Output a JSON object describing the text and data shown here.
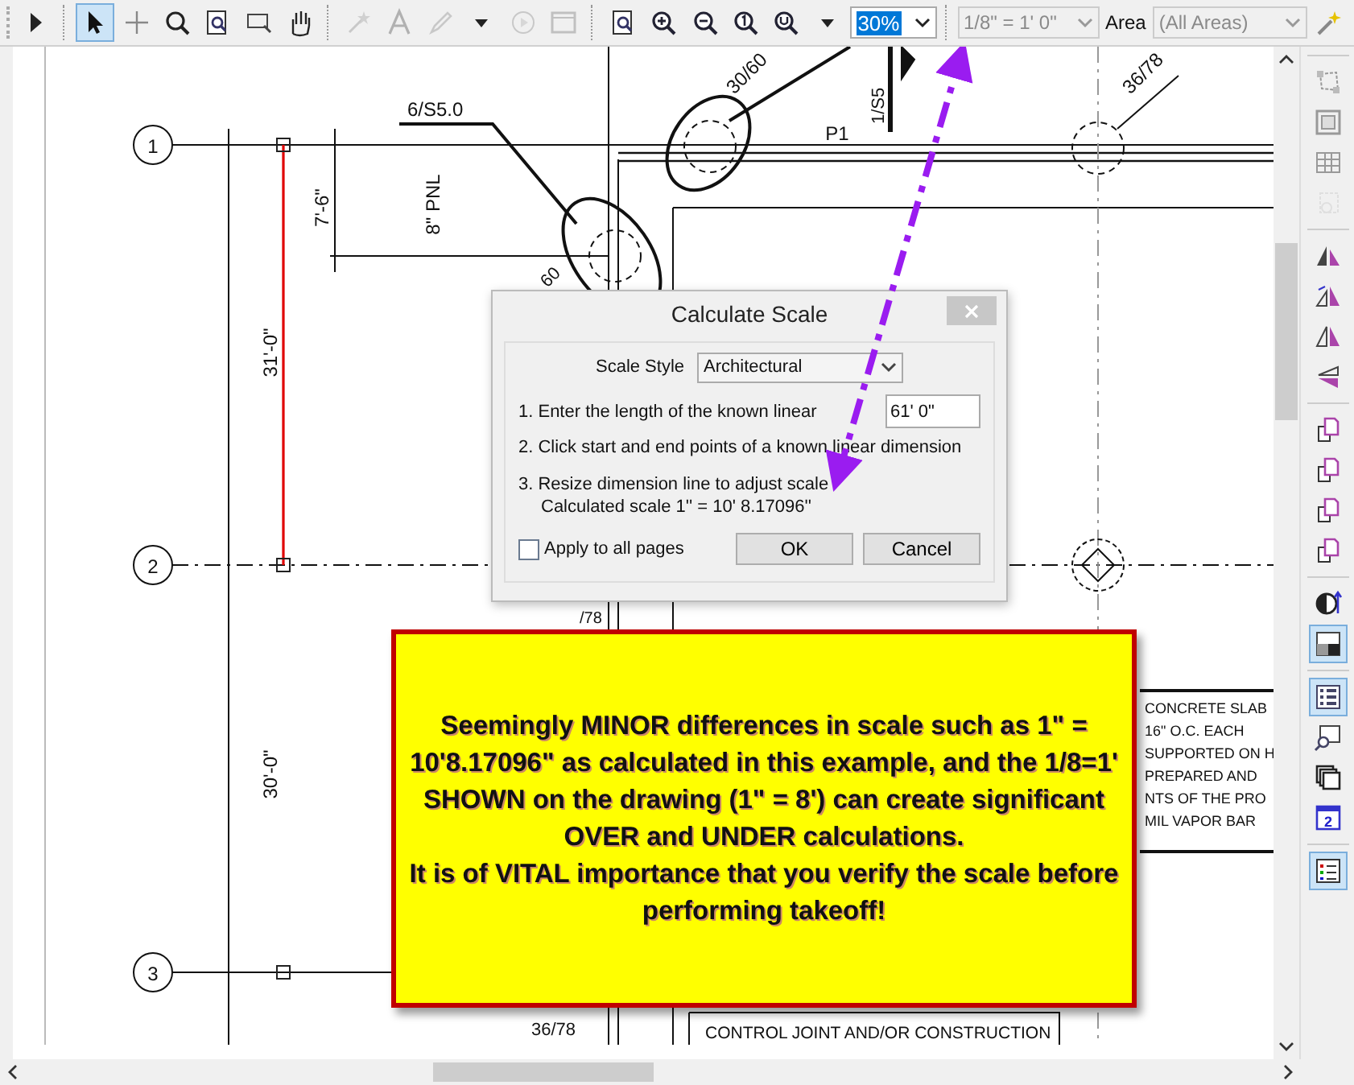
{
  "toolbar": {
    "tools": [
      {
        "kind": "play",
        "selected": false,
        "disabled": false
      },
      {
        "kind": "sep"
      },
      {
        "kind": "pointer",
        "selected": true,
        "disabled": false
      },
      {
        "kind": "crosshair",
        "selected": false,
        "disabled": false
      },
      {
        "kind": "zoom",
        "selected": false,
        "disabled": false
      },
      {
        "kind": "zoom-page",
        "selected": false,
        "disabled": false
      },
      {
        "kind": "zoom-rect",
        "selected": false,
        "disabled": false
      },
      {
        "kind": "hand",
        "selected": false,
        "disabled": false
      },
      {
        "kind": "sep"
      },
      {
        "kind": "star-pen",
        "selected": false,
        "disabled": true
      },
      {
        "kind": "letter",
        "selected": false,
        "disabled": true
      },
      {
        "kind": "pencil",
        "selected": false,
        "disabled": true
      },
      {
        "kind": "caret",
        "selected": false,
        "disabled": false
      },
      {
        "kind": "circle-play",
        "selected": false,
        "disabled": true
      },
      {
        "kind": "window",
        "selected": false,
        "disabled": true
      },
      {
        "kind": "sep"
      },
      {
        "kind": "zoom-page",
        "selected": false,
        "disabled": false
      },
      {
        "kind": "zoom-in",
        "selected": false,
        "disabled": false
      },
      {
        "kind": "zoom-out",
        "selected": false,
        "disabled": false
      },
      {
        "kind": "zoom-one",
        "selected": false,
        "disabled": false
      },
      {
        "kind": "zoom-u",
        "selected": false,
        "disabled": false
      },
      {
        "kind": "caret",
        "selected": false,
        "disabled": false
      }
    ],
    "zoom_field": {
      "value": "30%"
    },
    "scale_select": {
      "value": "1/8\" = 1' 0\"",
      "disabled": true
    },
    "area_label": "Area",
    "area_select": {
      "value": "(All Areas)",
      "disabled": true
    }
  },
  "drawing": {
    "labels": [
      "1",
      "2",
      "3",
      "6/S5.0",
      "7'-6\"",
      "8\" PNL",
      "30/60",
      "P1",
      "1/S5",
      "36/78",
      "31'-0\"",
      "30'-0\"",
      "60",
      "36/78",
      "/78",
      "CONCRETE SLAB",
      "16\" O.C. EACH",
      "SUPPORTED ON H",
      "PREPARED AND",
      "NTS OF THE PRO",
      "MIL VAPOR BAR",
      "CONTROL JOINT AND/OR CONSTRUCTION"
    ]
  },
  "dialog": {
    "title": "Calculate Scale",
    "scale_style_label": "Scale Style",
    "scale_style_value": "Architectural",
    "step_1": "1. Enter the length of the known linear",
    "length_value": "61' 0\"",
    "step_2": "2. Click start and end points of a known linear dimension",
    "step_3": "3. Resize dimension line to adjust scale",
    "calculated": "Calculated scale  1'' = 10' 8.17096''",
    "apply_all": {
      "label": "Apply to all pages",
      "checked": false
    },
    "buttons": [
      "OK",
      "Cancel"
    ]
  },
  "callout": {
    "paragraphs": [
      "Seemingly MINOR differences in scale such as 1\" = 10'8.17096\" as calculated in this example, and the 1/8=1' SHOWN on the drawing (1\" = 8') can create significant OVER and UNDER calculations.",
      "It is of VITAL importance that you verify the scale before performing takeoff!"
    ]
  },
  "side_toolbar": {
    "groups": [
      [
        {
          "kind": "polygon",
          "selected": false,
          "disabled": false
        },
        {
          "kind": "hatch",
          "selected": false,
          "disabled": false
        },
        {
          "kind": "grid",
          "selected": false,
          "disabled": false
        },
        {
          "kind": "shape",
          "selected": false,
          "disabled": true
        }
      ],
      [
        {
          "kind": "tri-a",
          "selected": false,
          "disabled": false
        },
        {
          "kind": "tri-b",
          "selected": false,
          "disabled": false
        },
        {
          "kind": "tri-c",
          "selected": false,
          "disabled": false
        },
        {
          "kind": "tri-d",
          "selected": false,
          "disabled": false
        }
      ],
      [
        {
          "kind": "page",
          "selected": false,
          "disabled": false
        },
        {
          "kind": "page",
          "selected": false,
          "disabled": false
        },
        {
          "kind": "page",
          "selected": false,
          "disabled": false
        },
        {
          "kind": "page",
          "selected": false,
          "disabled": false
        }
      ],
      [
        {
          "kind": "contrast",
          "selected": false,
          "disabled": false
        },
        {
          "kind": "gradient",
          "selected": true,
          "disabled": false
        }
      ],
      [
        {
          "kind": "list",
          "selected": true,
          "disabled": false
        },
        {
          "kind": "zoom-doc",
          "selected": false,
          "disabled": false
        },
        {
          "kind": "windows",
          "selected": false,
          "disabled": false
        },
        {
          "kind": "calendar",
          "label": "2",
          "selected": false,
          "disabled": false
        }
      ],
      [
        {
          "kind": "legend",
          "selected": true,
          "disabled": false
        }
      ]
    ]
  }
}
